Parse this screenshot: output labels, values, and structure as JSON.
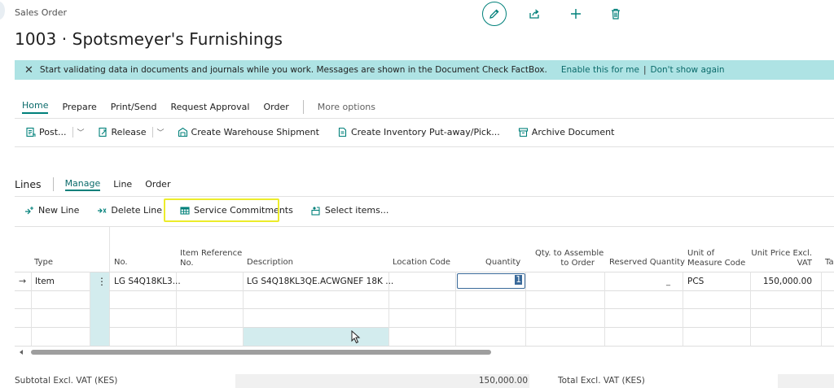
{
  "page": {
    "breadcrumb": "Sales Order",
    "title": "1003 · Spotsmeyer's Furnishings"
  },
  "top_actions": [
    {
      "icon": "edit-icon"
    },
    {
      "icon": "share-icon"
    },
    {
      "icon": "plus-icon"
    },
    {
      "icon": "delete-icon"
    }
  ],
  "banner": {
    "message": "Start validating data in documents and journals while you work. Messages are shown in the Document Check FactBox.",
    "enable_link": "Enable this for me",
    "separator": "|",
    "dismiss_link": "Don't show again"
  },
  "menu": {
    "items": [
      "Home",
      "Prepare",
      "Print/Send",
      "Request Approval",
      "Order"
    ],
    "more": "More options"
  },
  "actions": {
    "post": "Post...",
    "release": "Release",
    "warehouse_shipment": "Create Warehouse Shipment",
    "inventory_putaway": "Create Inventory Put-away/Pick...",
    "archive": "Archive Document"
  },
  "lines": {
    "title": "Lines",
    "tabs": [
      "Manage",
      "Line",
      "Order"
    ],
    "actions": {
      "new_line": "New Line",
      "delete_line": "Delete Line",
      "service_commitments": "Service Commitments",
      "select_items": "Select items..."
    }
  },
  "grid": {
    "headers": {
      "type": "Type",
      "no": "No.",
      "item_ref_1": "Item Reference",
      "item_ref_2": "No.",
      "description": "Description",
      "location": "Location Code",
      "quantity": "Quantity",
      "qty_assemble_1": "Qty. to Assemble",
      "qty_assemble_2": "to Order",
      "reserved": "Reserved Quantity",
      "uom_1": "Unit of",
      "uom_2": "Measure Code",
      "price_1": "Unit Price Excl.",
      "price_2": "VAT",
      "tax": "Tax"
    },
    "row1": {
      "arrow": "→",
      "type": "Item",
      "menu": "⋮",
      "no": "LG S4Q18KL3...",
      "description": "LG S4Q18KL3QE.ACWGNEF 18K ...",
      "quantity": "1",
      "reserved": "_",
      "uom": "PCS",
      "price": "150,000.00"
    }
  },
  "totals": {
    "subtotal_label": "Subtotal Excl. VAT (KES)",
    "subtotal_value": "150,000.00",
    "total_label": "Total Excl. VAT (KES)"
  }
}
